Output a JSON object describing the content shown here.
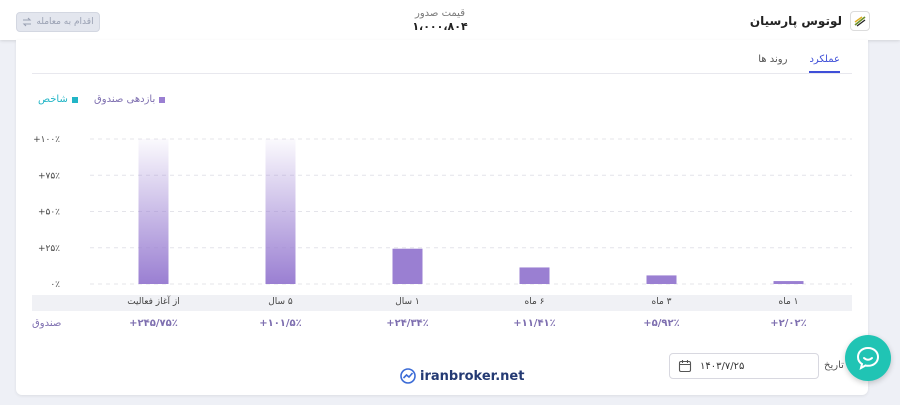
{
  "header": {
    "fund_name": "لوتوس پارسیان",
    "price_label": "قیمت صدور",
    "price_value": "۱،۰۰۰،۸۰۴",
    "trade_button": "اقدام به معامله",
    "logo_icon": "fund-logo-icon"
  },
  "tabs": [
    {
      "label": "عملکرد",
      "active": true
    },
    {
      "label": "روند ها",
      "active": false
    }
  ],
  "legend": {
    "fund": "بازدهی صندوق",
    "index": "شاخص",
    "fund_color": "#9a7fd2",
    "index_color": "#22b5c6"
  },
  "chart_data": {
    "type": "bar",
    "categories": [
      "۱ ماه",
      "۳ ماه",
      "۶ ماه",
      "۱ سال",
      "۵ سال",
      "از آغاز فعالیت"
    ],
    "series": [
      {
        "name": "بازدهی صندوق",
        "values": [
          2.02,
          5.92,
          11.41,
          24.34,
          101.5,
          245.75
        ]
      }
    ],
    "y_ticks": [
      "+۱۰۰٪",
      "+۷۵٪",
      "+۵۰٪",
      "+۲۵٪",
      "۰٪"
    ],
    "ylim": [
      0,
      100
    ],
    "grid": true
  },
  "table": {
    "row_name": "صندوق",
    "values": [
      "+۲/۰۲٪",
      "+۵/۹۲٪",
      "+۱۱/۴۱٪",
      "+۲۴/۳۴٪",
      "+۱۰۱/۵٪",
      "+۲۴۵/۷۵٪"
    ]
  },
  "date": {
    "label": "تاریخ",
    "value": "۱۴۰۳/۷/۲۵"
  },
  "watermark": "iranbroker.net"
}
